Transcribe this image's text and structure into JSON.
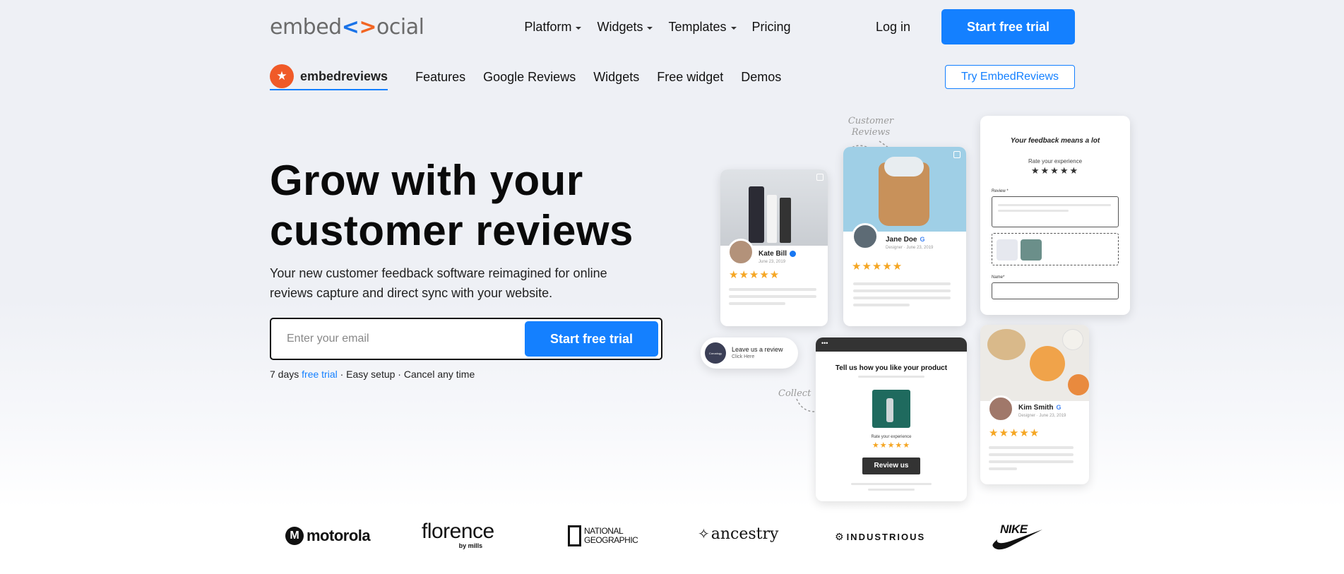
{
  "topnav": {
    "logo_prefix": "embed",
    "logo_lt": "<",
    "logo_gt": ">",
    "logo_suffix": "ocial",
    "menu": [
      {
        "label": "Platform"
      },
      {
        "label": "Widgets"
      },
      {
        "label": "Templates"
      },
      {
        "label": "Pricing"
      }
    ],
    "login": "Log in",
    "cta": "Start free trial"
  },
  "subnav": {
    "brand": "embedreviews",
    "menu": [
      "Features",
      "Google Reviews",
      "Widgets",
      "Free widget",
      "Demos"
    ],
    "cta": "Try EmbedReviews"
  },
  "hero": {
    "title_line1": "Grow with your",
    "title_line2": "customer reviews",
    "subtitle": "Your new customer feedback software reimagined for online reviews capture and direct sync with your website.",
    "email_placeholder": "Enter your email",
    "cta": "Start free trial",
    "fine_prefix": "7 days ",
    "fine_link": "free trial",
    "fine_suffix": " · Easy setup · Cancel any time"
  },
  "illustration": {
    "label_customer_reviews": "Customer Reviews",
    "label_collect": "Collect",
    "card1": {
      "name": "Kate Bill",
      "meta": "June 23, 2019",
      "stars": "★★★★★"
    },
    "card2": {
      "name": "Jane Doe",
      "meta": "Designer · June 23, 2019",
      "stars": "★★★★★"
    },
    "card3": {
      "name": "Kim Smith",
      "meta": "Designer · June 23, 2019",
      "stars": "★★★★★"
    },
    "form": {
      "title": "Your feedback means a lot",
      "rate": "Rate your experience",
      "stars": "★★★★★",
      "review_label": "Review *",
      "name_label": "Name*"
    },
    "leave": {
      "brand": "Coroalogy",
      "title": "Leave us a review",
      "link": "Click Here"
    },
    "product": {
      "title": "Tell us how you like your product",
      "rate": "Rate your experience",
      "stars": "★★★★★",
      "button": "Review us",
      "dots": "•••"
    }
  },
  "logos": {
    "motorola": "motorola",
    "florence": "florence",
    "florence_sub": "by mills",
    "natgeo_1": "NATIONAL",
    "natgeo_2": "GEOGRAPHIC",
    "ancestry": "ancestry",
    "industrious": "INDUSTRIOUS",
    "nike": "NIKE"
  }
}
